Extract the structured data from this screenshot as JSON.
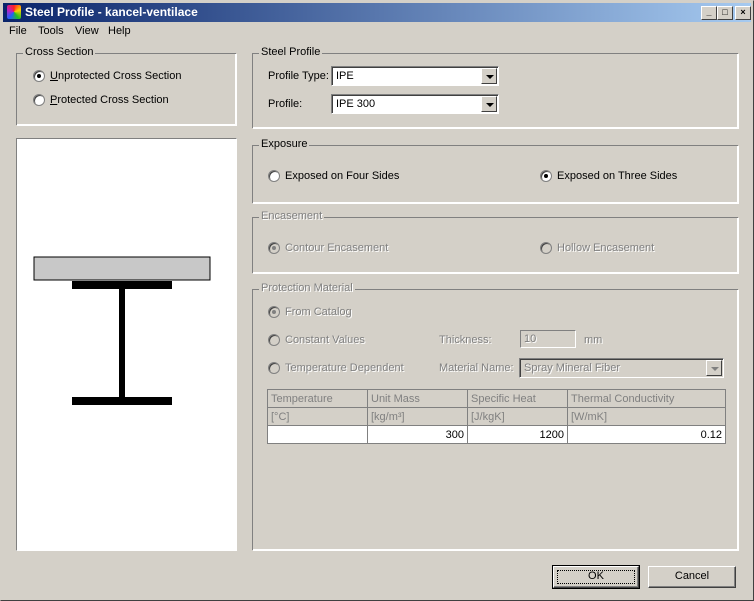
{
  "window": {
    "title": "Steel Profile - kancel-ventilace",
    "controls": [
      "_",
      "□",
      "×"
    ]
  },
  "menu": [
    "File",
    "Tools",
    "View",
    "Help"
  ],
  "cross_section": {
    "title": "Cross Section",
    "options": [
      {
        "label": "Unprotected Cross Section",
        "checked": true
      },
      {
        "label": "Protected Cross Section",
        "checked": false
      }
    ]
  },
  "steel_profile": {
    "title": "Steel Profile",
    "profile_type_label": "Profile Type:",
    "profile_type_value": "IPE",
    "profile_label": "Profile:",
    "profile_value": "IPE 300"
  },
  "exposure": {
    "title": "Exposure",
    "options": [
      {
        "label": "Exposed on Four Sides",
        "checked": false
      },
      {
        "label": "Exposed on Three Sides",
        "checked": true
      }
    ]
  },
  "encasement": {
    "title": "Encasement",
    "enabled": false,
    "options": [
      {
        "label": "Contour Encasement",
        "checked": true
      },
      {
        "label": "Hollow Encasement",
        "checked": false
      }
    ]
  },
  "protection_material": {
    "title": "Protection Material",
    "enabled": false,
    "options": [
      {
        "label": "From Catalog",
        "checked": true
      },
      {
        "label": "Constant Values",
        "checked": false
      },
      {
        "label": "Temperature Dependent",
        "checked": false
      }
    ],
    "thickness_label": "Thickness:",
    "thickness_value": "10",
    "thickness_unit": "mm",
    "material_name_label": "Material Name:",
    "material_name_value": "Spray Mineral Fiber",
    "table": {
      "headers": [
        "Temperature",
        "Unit Mass",
        "Specific Heat",
        "Thermal Conductivity"
      ],
      "units": [
        "[°C]",
        "[kg/m³]",
        "[J/kgK]",
        "[W/mK]"
      ],
      "rows": [
        [
          "",
          "300",
          "1200",
          "0.12"
        ]
      ]
    }
  },
  "buttons": {
    "ok": "OK",
    "cancel": "Cancel"
  },
  "colors": {
    "face": "#d4d0c8",
    "title_start": "#0a246a",
    "title_end": "#a6caf0",
    "steel": "#000000",
    "slab": "#c8c8c8"
  }
}
